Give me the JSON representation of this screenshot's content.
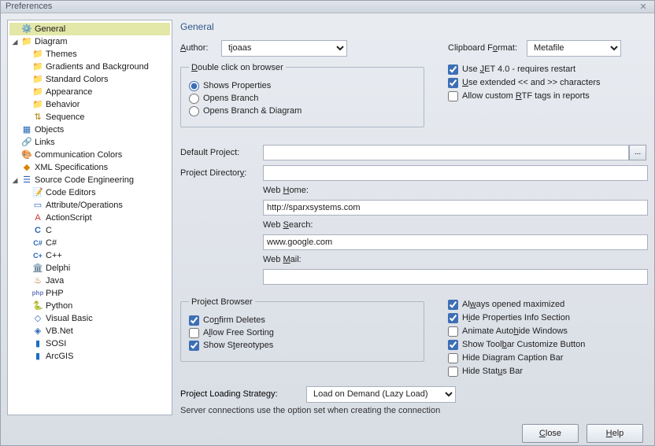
{
  "window": {
    "title": "Preferences"
  },
  "tree": {
    "general": "General",
    "diagram": "Diagram",
    "diagram_children": {
      "themes": "Themes",
      "gradients": "Gradients and Background",
      "standard_colors": "Standard Colors",
      "appearance": "Appearance",
      "behavior": "Behavior",
      "sequence": "Sequence"
    },
    "objects": "Objects",
    "links": "Links",
    "comm_colors": "Communication Colors",
    "xml_spec": "XML Specifications",
    "sce": "Source Code Engineering",
    "sce_children": {
      "code_editors": "Code Editors",
      "attr_ops": "Attribute/Operations",
      "actionscript": "ActionScript",
      "c": "C",
      "csharp": "C#",
      "cpp": "C++",
      "delphi": "Delphi",
      "java": "Java",
      "php": "PHP",
      "python": "Python",
      "vb": "Visual Basic",
      "vbnet": "VB.Net",
      "sosi": "SOSI",
      "arcgis": "ArcGIS"
    }
  },
  "main": {
    "heading": "General",
    "author_label": "Author:",
    "author_value": "tjoaas",
    "clip_label": "Clipboard Format:",
    "clip_value": "Metafile",
    "dblclick": {
      "legend": "Double click on browser",
      "shows_properties": "Shows Properties",
      "opens_branch": "Opens Branch",
      "opens_branch_diagram": "Opens Branch  & Diagram"
    },
    "jet": "Use JET 4.0 - requires restart",
    "ext_chars": "Use extended << and >> characters",
    "rtf": "Allow custom RTF tags in reports",
    "default_project": "Default Project:",
    "project_dir": "Project Directory:",
    "web_home": "Web Home:",
    "web_home_val": "http://sparxsystems.com",
    "web_search": "Web Search:",
    "web_search_val": "www.google.com",
    "web_mail": "Web Mail:",
    "project_browser": {
      "legend": "Project Browser",
      "confirm_deletes": "Confirm Deletes",
      "free_sort": "Allow Free Sorting",
      "stereotypes": "Show Stereotypes"
    },
    "right_opts": {
      "maximized": "Always opened maximized",
      "hide_props": "Hide Properties Info Section",
      "autohide": "Animate Autohide Windows",
      "toolbar": "Show Toolbar Customize Button",
      "caption": "Hide Diagram Caption Bar",
      "status": "Hide Status Bar"
    },
    "strategy_label": "Project Loading Strategy:",
    "strategy_value": "Load on Demand (Lazy Load)",
    "hint": "Server connections use the option set when creating the connection"
  },
  "footer": {
    "close": "Close",
    "help": "Help"
  }
}
